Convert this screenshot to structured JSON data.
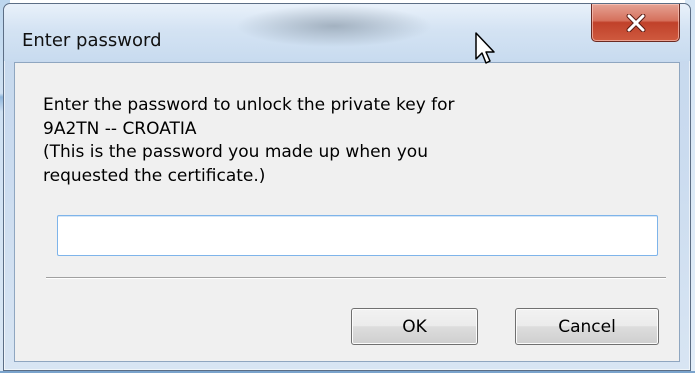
{
  "dialog": {
    "title": "Enter password",
    "close_label": "X",
    "message": {
      "line1": "Enter the password to unlock the private key for",
      "line2": "9A2TN -- CROATIA",
      "line3": "(This is the password you made up when you",
      "line4": "requested the certificate.)"
    },
    "password_value": "",
    "ok_label": "OK",
    "cancel_label": "Cancel"
  },
  "icons": {
    "close": "close-icon",
    "cursor": "mouse-pointer-icon"
  },
  "colors": {
    "close_button": "#c0412a",
    "input_border": "#7eb4ea",
    "client_background": "#f0f0f0"
  }
}
